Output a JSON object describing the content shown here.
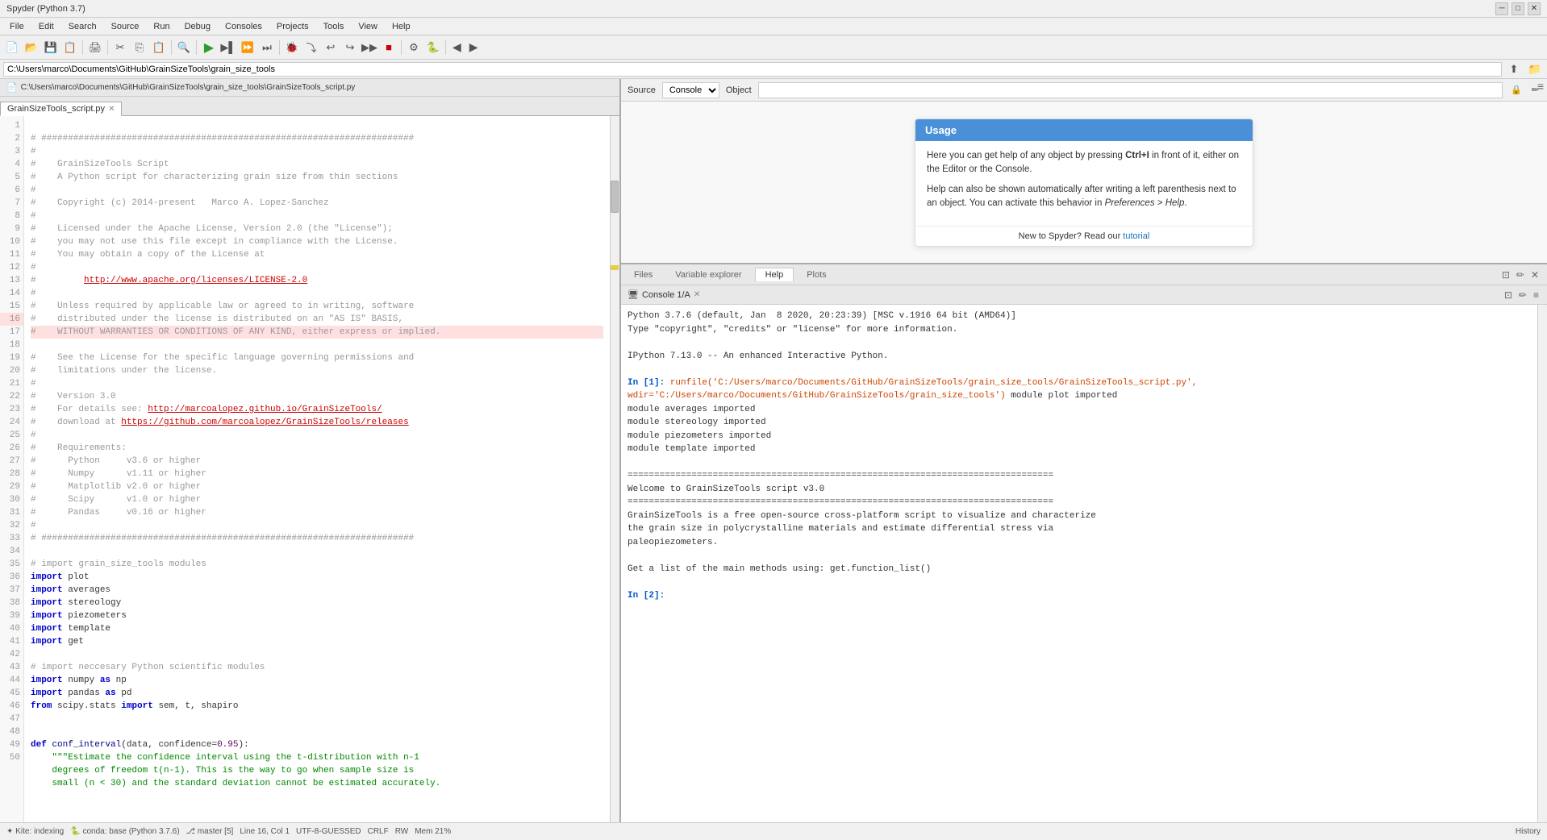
{
  "app": {
    "title": "Spyder (Python 3.7)"
  },
  "menu": {
    "items": [
      "File",
      "Edit",
      "Search",
      "Source",
      "Run",
      "Debug",
      "Consoles",
      "Projects",
      "Tools",
      "View",
      "Help"
    ]
  },
  "toolbar": {
    "buttons": [
      "new",
      "open",
      "save",
      "save-all",
      "print",
      "cut",
      "copy",
      "paste",
      "find",
      "run",
      "run-file",
      "run-cell",
      "run-cell-advance",
      "debug",
      "step-over",
      "step-into",
      "step-return",
      "stop-debug",
      "continue",
      "stop",
      "profile",
      "conda",
      "back",
      "forward"
    ],
    "run_color": "#2a9d2a"
  },
  "path_bar": {
    "path": "C:\\Users\\marco\\Documents\\GitHub\\GrainSizeTools\\grain_size_tools"
  },
  "filepath_bar": {
    "path": "C:\\Users\\marco\\Documents\\GitHub\\GrainSizeTools\\grain_size_tools\\GrainSizeTools_script.py"
  },
  "editor": {
    "tabs": [
      {
        "label": "GrainSizeTools_script.py",
        "active": true
      }
    ],
    "lines": [
      {
        "num": 1,
        "text": "# ##############################################################",
        "type": "comment"
      },
      {
        "num": 2,
        "text": "#",
        "type": "comment"
      },
      {
        "num": 3,
        "text": "#    GrainSizeTools Script",
        "type": "comment"
      },
      {
        "num": 4,
        "text": "#    A Python script for characterizing grain size from thin sections",
        "type": "comment"
      },
      {
        "num": 5,
        "text": "#",
        "type": "comment"
      },
      {
        "num": 6,
        "text": "#    Copyright (c) 2014-present   Marco A. Lopez-Sanchez",
        "type": "comment"
      },
      {
        "num": 7,
        "text": "#",
        "type": "comment"
      },
      {
        "num": 8,
        "text": "#    Licensed under the Apache License, Version 2.0 (the \"License\");",
        "type": "comment"
      },
      {
        "num": 9,
        "text": "#    you may not use this file except in compliance with the License.",
        "type": "comment"
      },
      {
        "num": 10,
        "text": "#    You may obtain a copy of the License at",
        "type": "comment"
      },
      {
        "num": 11,
        "text": "#",
        "type": "comment"
      },
      {
        "num": 12,
        "text": "#         http://www.apache.org/licenses/LICENSE-2.0",
        "type": "comment_url"
      },
      {
        "num": 13,
        "text": "#",
        "type": "comment"
      },
      {
        "num": 14,
        "text": "#    Unless required by applicable law or agreed to in writing, software",
        "type": "comment"
      },
      {
        "num": 15,
        "text": "#    distributed under the license is distributed on an \"AS IS\" BASIS,",
        "type": "comment"
      },
      {
        "num": 16,
        "text": "#    WITHOUT WARRANTIES OR CONDITIONS OF ANY KIND, either express or implied.",
        "type": "comment_highlight"
      },
      {
        "num": 17,
        "text": "#    See the License for the specific language governing permissions and",
        "type": "comment"
      },
      {
        "num": 18,
        "text": "#    limitations under the license.",
        "type": "comment"
      },
      {
        "num": 19,
        "text": "#",
        "type": "comment"
      },
      {
        "num": 20,
        "text": "#    Version 3.0",
        "type": "comment"
      },
      {
        "num": 21,
        "text": "#    For details see: http://marcoalopez.github.io/GrainSizeTools/",
        "type": "comment_url2"
      },
      {
        "num": 22,
        "text": "#    download at https://github.com/marcoalopez/GrainSizeTools/releases",
        "type": "comment_url3"
      },
      {
        "num": 23,
        "text": "#",
        "type": "comment"
      },
      {
        "num": 24,
        "text": "#    Requirements:",
        "type": "comment"
      },
      {
        "num": 25,
        "text": "#      Python     v3.6 or higher",
        "type": "comment"
      },
      {
        "num": 26,
        "text": "#      Numpy      v1.11 or higher",
        "type": "comment"
      },
      {
        "num": 27,
        "text": "#      Matplotlib v2.0 or higher",
        "type": "comment"
      },
      {
        "num": 28,
        "text": "#      Scipy      v1.0 or higher",
        "type": "comment"
      },
      {
        "num": 29,
        "text": "#      Pandas     v0.16 or higher",
        "type": "comment"
      },
      {
        "num": 30,
        "text": "#",
        "type": "comment"
      },
      {
        "num": 31,
        "text": "# ##############################################################",
        "type": "comment"
      },
      {
        "num": 32,
        "text": "",
        "type": "blank"
      },
      {
        "num": 33,
        "text": "# import grain_size_tools modules",
        "type": "comment"
      },
      {
        "num": 34,
        "text": "import plot",
        "type": "import",
        "warn": true
      },
      {
        "num": 35,
        "text": "import averages",
        "type": "import"
      },
      {
        "num": 36,
        "text": "import stereology",
        "type": "import",
        "warn": true
      },
      {
        "num": 37,
        "text": "import piezometers",
        "type": "import",
        "warn": true
      },
      {
        "num": 38,
        "text": "import template",
        "type": "import",
        "warn": true
      },
      {
        "num": 39,
        "text": "import get",
        "type": "import",
        "warn": true
      },
      {
        "num": 40,
        "text": "",
        "type": "blank"
      },
      {
        "num": 41,
        "text": "# import neccesary Python scientific modules",
        "type": "comment"
      },
      {
        "num": 42,
        "text": "import numpy as np",
        "type": "import"
      },
      {
        "num": 43,
        "text": "import pandas as pd",
        "type": "import",
        "warn": true
      },
      {
        "num": 44,
        "text": "from scipy.stats import sem, t, shapiro",
        "type": "import"
      },
      {
        "num": 45,
        "text": "",
        "type": "blank"
      },
      {
        "num": 46,
        "text": "",
        "type": "blank"
      },
      {
        "num": 47,
        "text": "def conf_interval(data, confidence=0.95):",
        "type": "def"
      },
      {
        "num": 48,
        "text": "    \"\"\"Estimate the confidence interval using the t-distribution with n-1",
        "type": "docstring"
      },
      {
        "num": 49,
        "text": "    degrees of freedom t(n-1). This is the way to go when sample size is",
        "type": "docstring"
      },
      {
        "num": 50,
        "text": "    small (n < 30) and the standard deviation cannot be estimated accurately.",
        "type": "docstring"
      }
    ]
  },
  "help_panel": {
    "source_label": "Source",
    "console_option": "Console",
    "object_label": "Object",
    "usage_title": "Usage",
    "usage_p1": "Here you can get help of any object by pressing Ctrl+I in front of it, either on the Editor or the Console.",
    "usage_p2": "Help can also be shown automatically after writing a left parenthesis next to an object. You can activate this behavior in Preferences > Help.",
    "usage_footer_prefix": "New to Spyder? Read our ",
    "usage_footer_link": "tutorial"
  },
  "bottom_pane": {
    "tabs": [
      "Files",
      "Variable explorer",
      "Help",
      "Plots"
    ],
    "active_tab": "Help",
    "console_tab_label": "Console 1/A"
  },
  "console": {
    "startup": "Python 3.7.6 (default, Jan  8 2020, 20:23:39) [MSC v.1916 64 bit (AMD64)]\nType \"copyright\", \"credits\" or \"license\" for more information.\n\nIPython 7.13.0 -- An enhanced Interactive Python.\n",
    "in1_prompt": "In [1]:",
    "in1_code": " runfile('C:/Users/marco/Documents/GitHub/GrainSizeTools/grain_size_tools/GrainSizeTools_script.py',\n    wdir='C:/Users/marco/Documents/GitHub/GrainSizeTools/grain_size_tools')",
    "in1_output": "module plot imported\nmodule averages imported\nmodule stereology imported\nmodule piezometers imported\nmodule template imported\n\n================================================================================\nWelcome to GrainSizeTools script v3.0\n================================================================================\nGrainSizeTools is a free open-source cross-platform script to visualize and characterize\nthe grain size in polycrystalline materials and estimate differential stress via\npaleopiezometers.\n\nGet a list of the main methods using: get.function_list()",
    "in2_prompt": "In [2]:"
  },
  "status_bar": {
    "kite_label": "Kite: indexing",
    "conda_label": "conda: base (Python 3.7.6)",
    "git_label": "master [5]",
    "line_col": "Line 16, Col 1",
    "encoding": "UTF-8-GUESSED",
    "line_ending": "CRLF",
    "rw": "RW",
    "mem": "Mem 21%",
    "history_label": "History"
  },
  "colors": {
    "accent_blue": "#4a90d9",
    "run_green": "#2a9d2a",
    "warning_orange": "#e0a000",
    "highlight_line": "#ffe0e0",
    "link_blue": "#1a6dbd"
  }
}
